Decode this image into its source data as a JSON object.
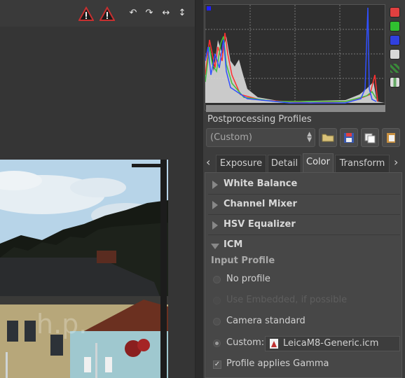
{
  "toolbar": {
    "warning1_icon": "warning-triangle-icon",
    "warning2_icon": "warning-triangle-icon",
    "rotate_left_glyph": "↶",
    "rotate_right_glyph": "↷",
    "flip_h_glyph": "↔",
    "flip_v_glyph": "↕"
  },
  "histogram": {
    "channels": [
      "red",
      "green",
      "blue",
      "luminance",
      "raw",
      "bar"
    ],
    "colors": {
      "red": "#ff4040",
      "green": "#40c040",
      "blue": "#4060ff"
    }
  },
  "postprocessing": {
    "label": "Postprocessing Profiles",
    "selected": "(Custom)"
  },
  "tabs": [
    {
      "label": "Exposure",
      "active": false
    },
    {
      "label": "Detail",
      "active": false
    },
    {
      "label": "Color",
      "active": true
    },
    {
      "label": "Transform",
      "active": false
    }
  ],
  "sections": {
    "white_balance": "White Balance",
    "channel_mixer": "Channel Mixer",
    "hsv_equalizer": "HSV Equalizer",
    "icm": "ICM"
  },
  "icm": {
    "input_profile_label": "Input Profile",
    "options": {
      "no_profile": "No profile",
      "use_embedded": "Use Embedded, if possible",
      "camera_standard": "Camera standard",
      "custom": "Custom:"
    },
    "custom_file": "LeicaM8-Generic.icm",
    "gamma_label": "Profile applies Gamma"
  },
  "photo": {
    "watermark": "h.p."
  }
}
